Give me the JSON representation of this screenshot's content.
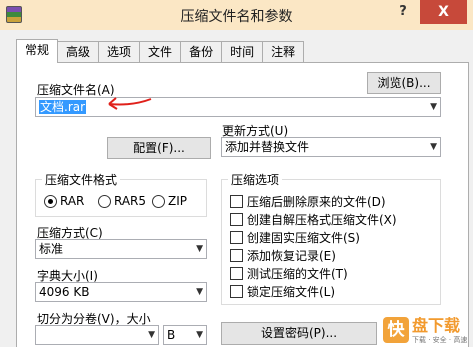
{
  "window": {
    "title": "压缩文件名和参数",
    "help": "?",
    "close": "X"
  },
  "tabs": [
    {
      "label": "常规",
      "active": true
    },
    {
      "label": "高级"
    },
    {
      "label": "选项"
    },
    {
      "label": "文件"
    },
    {
      "label": "备份"
    },
    {
      "label": "时间"
    },
    {
      "label": "注释"
    }
  ],
  "archive_name": {
    "label": "压缩文件名(A)",
    "browse": "浏览(B)...",
    "value": "文档.rar"
  },
  "profiles_button": "配置(F)...",
  "update_mode": {
    "label": "更新方式(U)",
    "value": "添加并替换文件"
  },
  "archive_format": {
    "label": "压缩文件格式",
    "options": [
      "RAR",
      "RAR5",
      "ZIP"
    ],
    "selected": "RAR"
  },
  "compression_method": {
    "label": "压缩方式(C)",
    "value": "标准"
  },
  "dictionary_size": {
    "label": "字典大小(I)",
    "value": "4096 KB"
  },
  "split_volumes": {
    "label": "切分为分卷(V)，大小",
    "value": "",
    "unit": "B"
  },
  "password_button": "设置密码(P)...",
  "archiving_options": {
    "label": "压缩选项",
    "items": [
      "压缩后删除原来的文件(D)",
      "创建自解压格式压缩文件(X)",
      "创建固实压缩文件(S)",
      "添加恢复记录(E)",
      "测试压缩的文件(T)",
      "锁定压缩文件(L)"
    ]
  },
  "watermark": {
    "logo": "快",
    "text": "盘下载",
    "sub": "下载 · 安全 · 高速"
  },
  "colors": {
    "titlebar": "#fbe7c5",
    "close": "#c7493a",
    "selection": "#3399ff",
    "annotation": "#e0201a"
  }
}
